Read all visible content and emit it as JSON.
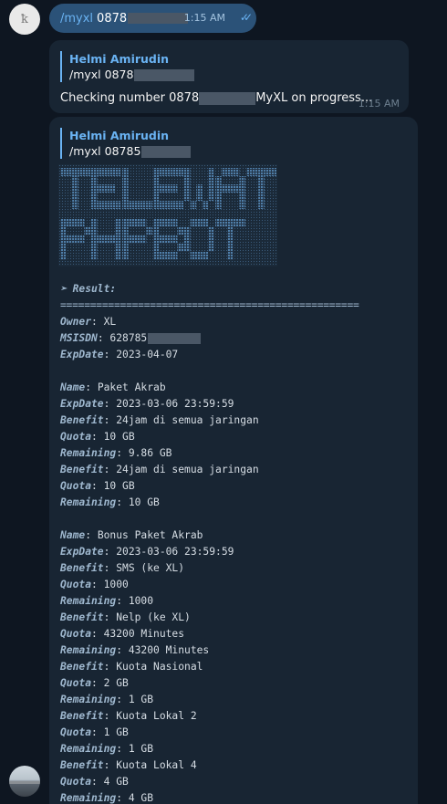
{
  "outgoing": {
    "command": "/myxl",
    "number_prefix": "0878",
    "time": "1:15 AM",
    "status": "read"
  },
  "reply_message": {
    "quote_name": "Helmi Amirudin",
    "quote_command": "/myxl 0878",
    "text_prefix": "Checking number 0878",
    "text_suffix": "MyXL on progress...",
    "time": "1:15 AM"
  },
  "result_message": {
    "quote_name": "Helmi Amirudin",
    "quote_command": "/myxl 08785",
    "banner_lines": [
      "TELEWAT",
      "PHPBOT"
    ],
    "header": "➣ Result:",
    "separator": "==================================================",
    "owner": {
      "key": "Owner",
      "value": "XL"
    },
    "msisdn": {
      "key": "MSISDN",
      "value": "628785"
    },
    "expdate": {
      "key": "ExpDate",
      "value": "2023-04-07"
    },
    "packages": [
      {
        "name": "Paket Akrab",
        "expdate": "2023-03-06 23:59:59",
        "items": [
          {
            "benefit": "24jam di semua jaringan",
            "quota": "10 GB",
            "remaining": "9.86 GB"
          },
          {
            "benefit": "24jam di semua jaringan",
            "quota": "10 GB",
            "remaining": "10 GB"
          }
        ]
      },
      {
        "name": "Bonus Paket Akrab",
        "expdate": "2023-03-06 23:59:59",
        "items": [
          {
            "benefit": "SMS (ke XL)",
            "quota": "1000",
            "remaining": "1000"
          },
          {
            "benefit": "Nelp (ke XL)",
            "quota": "43200 Minutes",
            "remaining": "43200 Minutes"
          },
          {
            "benefit": "Kuota Nasional",
            "quota": "2 GB",
            "remaining": "1 GB"
          },
          {
            "benefit": "Kuota Lokal 2",
            "quota": "1 GB",
            "remaining": "1 GB"
          },
          {
            "benefit": "Kuota Lokal 4",
            "quota": "4 GB",
            "remaining": "4 GB"
          }
        ]
      }
    ]
  },
  "colors": {
    "background": "#0e1621",
    "outgoing_bubble": "#2b5278",
    "incoming_bubble": "#182533",
    "accent": "#6ab3f3",
    "banner": "#5b8fc4"
  }
}
